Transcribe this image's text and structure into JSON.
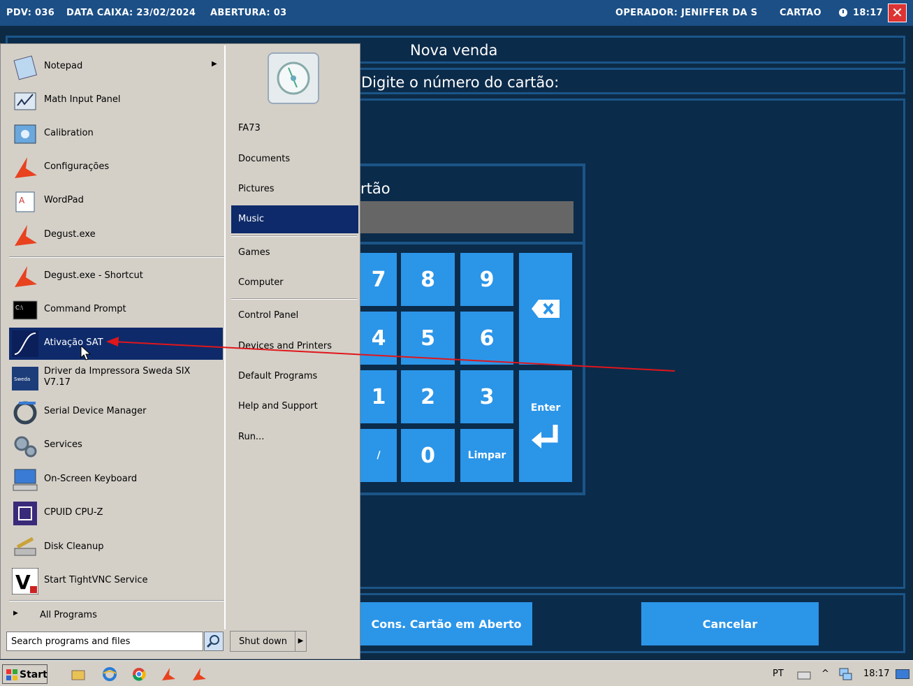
{
  "topbar": {
    "pdv": "PDV: 036",
    "data_caixa": "DATA CAIXA: 23/02/2024",
    "abertura": "ABERTURA: 03",
    "operador": "OPERADOR: JENIFFER DA S",
    "mode": "CARTAO",
    "time": "18:17"
  },
  "app": {
    "title": "Nova venda",
    "prompt": "Digite o número do cartão:",
    "keypad_label": "rtão",
    "keys": [
      "7",
      "8",
      "9",
      "4",
      "5",
      "6",
      "1",
      "2",
      "3",
      "/",
      "0",
      "Limpar"
    ],
    "enter_label": "Enter",
    "btn_cons": "Cons. Cartão em Aberto",
    "btn_cancel": "Cancelar"
  },
  "start_menu": {
    "left_items": [
      {
        "label": "Notepad",
        "icon": "notepad-icon"
      },
      {
        "label": "Math Input Panel",
        "icon": "math-input-icon"
      },
      {
        "label": "Calibration",
        "icon": "calibration-icon"
      },
      {
        "label": "Configurações",
        "icon": "degust-icon"
      },
      {
        "label": "WordPad",
        "icon": "wordpad-icon"
      },
      {
        "label": "Degust.exe",
        "icon": "degust-icon"
      },
      {
        "label": "Degust.exe - Shortcut",
        "icon": "degust-icon"
      },
      {
        "label": "Command Prompt",
        "icon": "cmd-icon"
      },
      {
        "label": "Ativação SAT",
        "icon": "sat-icon"
      },
      {
        "label": "Driver da Impressora Sweda SIX V7.17",
        "icon": "sweda-icon"
      },
      {
        "label": "Serial Device Manager",
        "icon": "serial-icon"
      },
      {
        "label": "Services",
        "icon": "services-icon"
      },
      {
        "label": "On-Screen Keyboard",
        "icon": "keyboard-icon"
      },
      {
        "label": "CPUID CPU-Z",
        "icon": "cpuz-icon"
      },
      {
        "label": "Disk Cleanup",
        "icon": "disk-cleanup-icon"
      },
      {
        "label": "Start TightVNC Service",
        "icon": "vnc-icon"
      }
    ],
    "all_programs": "All Programs",
    "search_placeholder": "Search programs and files",
    "right_items": [
      "FA73",
      "Documents",
      "Pictures",
      "Music",
      "Games",
      "Computer",
      "Control Panel",
      "Devices and Printers",
      "Default Programs",
      "Help and Support",
      "Run..."
    ],
    "shutdown": "Shut down"
  },
  "taskbar": {
    "start": "Start",
    "lang": "PT",
    "time": "18:17"
  },
  "colors": {
    "accent": "#2b95e8",
    "selection": "#0e2a6a",
    "annotation": "#e0161b"
  }
}
